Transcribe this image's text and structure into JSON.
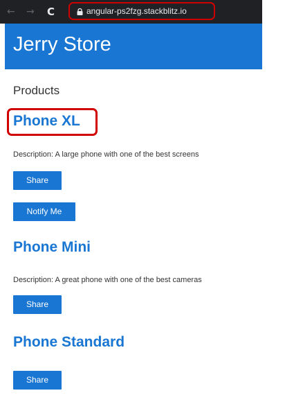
{
  "browser": {
    "back_icon": "←",
    "forward_icon": "→",
    "reload_icon": "C",
    "url": "angular-ps2fzg.stackblitz.io"
  },
  "header": {
    "title": "Jerry Store"
  },
  "page": {
    "heading": "Products"
  },
  "products": [
    {
      "name": "Phone XL",
      "description": "Description: A large phone with one of the best screens",
      "share_label": "Share",
      "notify_label": "Notify Me"
    },
    {
      "name": "Phone Mini",
      "description": "Description: A great phone with one of the best cameras",
      "share_label": "Share"
    },
    {
      "name": "Phone Standard",
      "share_label": "Share"
    }
  ],
  "colors": {
    "brand_blue": "#1976d2",
    "highlight_red": "#d10000",
    "browser_dark": "#202124"
  }
}
